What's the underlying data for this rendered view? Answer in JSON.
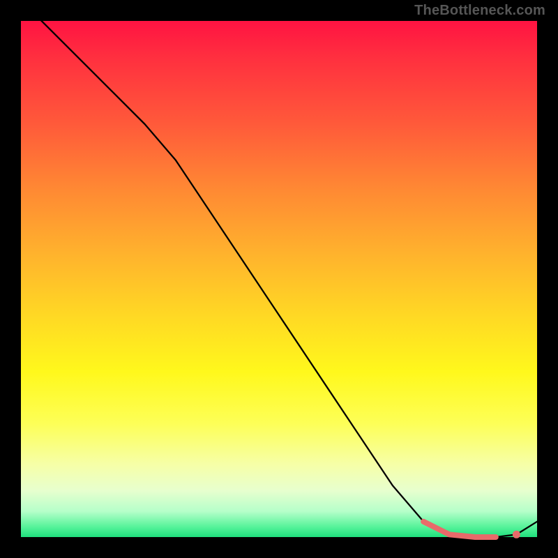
{
  "watermark": "TheBottleneck.com",
  "chart_data": {
    "type": "line",
    "title": "",
    "xlabel": "",
    "ylabel": "",
    "xlim": [
      0,
      100
    ],
    "ylim": [
      0,
      100
    ],
    "grid": false,
    "legend": false,
    "series": [
      {
        "name": "curve",
        "x": [
          0,
          6,
          12,
          18,
          24,
          30,
          36,
          42,
          48,
          54,
          60,
          66,
          72,
          78,
          83,
          88,
          92,
          96,
          100
        ],
        "values": [
          104,
          98,
          92,
          86,
          80,
          73,
          64,
          55,
          46,
          37,
          28,
          19,
          10,
          3,
          0.5,
          0,
          0,
          0.5,
          3
        ]
      }
    ],
    "trough_range": {
      "x_start": 78,
      "x_end": 92
    },
    "trough_end_dot": {
      "x": 96,
      "y": 0.5
    },
    "colors": {
      "curve": "#000000",
      "trough": "#e86a6a",
      "gradient_top": "#ff1342",
      "gradient_bottom": "#1fe07d"
    }
  }
}
